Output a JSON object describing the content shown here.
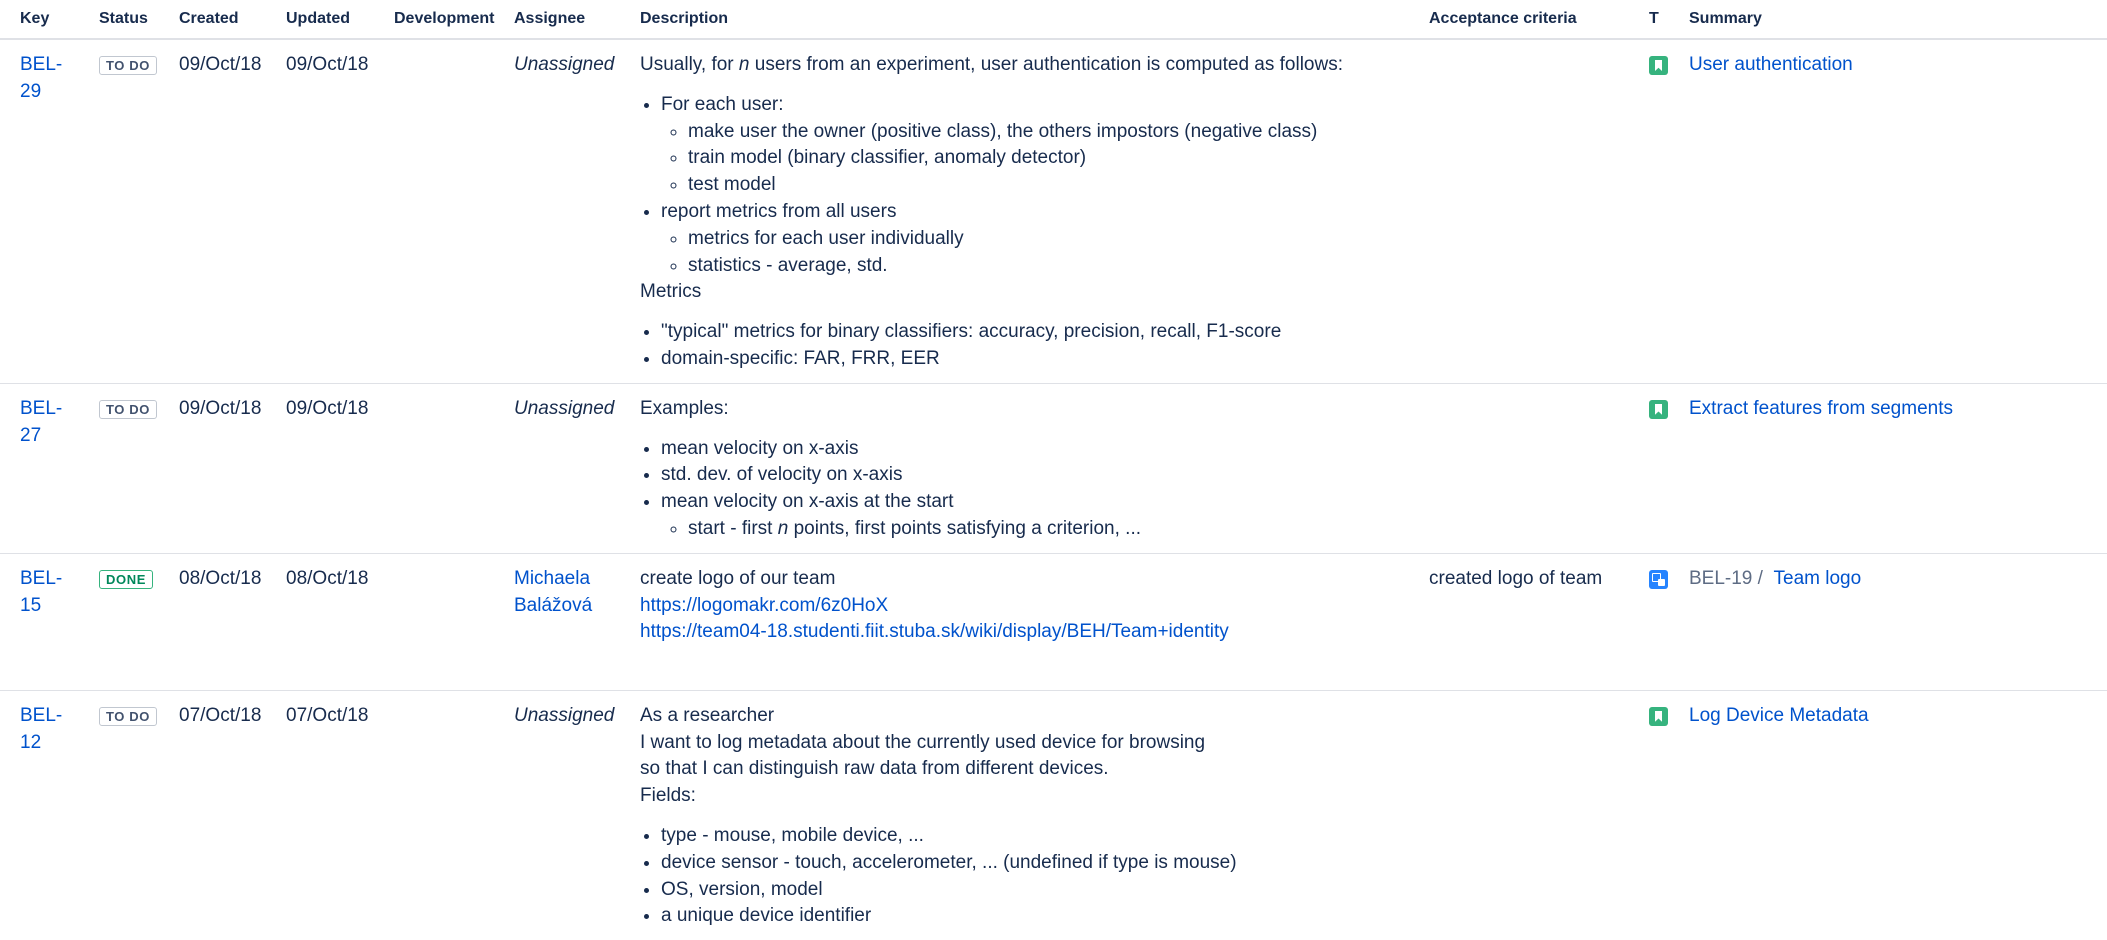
{
  "columns": {
    "key": "Key",
    "status": "Status",
    "created": "Created",
    "updated": "Updated",
    "development": "Development",
    "assignee": "Assignee",
    "description": "Description",
    "acceptance": "Acceptance criteria",
    "type": "T",
    "summary": "Summary"
  },
  "issues": [
    {
      "key": "BEL-29",
      "status": "TO DO",
      "created": "09/Oct/18",
      "updated": "09/Oct/18",
      "assignee": "Unassigned",
      "type_icon": "story-icon",
      "summary": "User authentication",
      "description": {
        "intro_pre": "Usually, for ",
        "intro_em": "n",
        "intro_post": " users from an experiment, user authentication is computed as follows:",
        "list1": [
          {
            "text": "For each user:",
            "sub": [
              "make user the owner (positive class), the others impostors (negative class)",
              "train model (binary classifier, anomaly detector)",
              "test model"
            ]
          },
          {
            "text": "report metrics from all users",
            "sub": [
              "metrics for each user individually",
              "statistics - average, std."
            ]
          }
        ],
        "heading": "Metrics",
        "list2": [
          "\"typical\" metrics for binary classifiers: accuracy, precision, recall, F1-score",
          "domain-specific: FAR, FRR, EER"
        ]
      }
    },
    {
      "key": "BEL-27",
      "status": "TO DO",
      "created": "09/Oct/18",
      "updated": "09/Oct/18",
      "assignee": "Unassigned",
      "type_icon": "story-icon",
      "summary": "Extract features from segments",
      "description": {
        "intro": "Examples:",
        "list": [
          "mean velocity on x-axis",
          "std. dev. of velocity on x-axis",
          "mean velocity on x-axis at the start"
        ],
        "sub_pre": "start - first ",
        "sub_em": "n",
        "sub_post": " points, first points satisfying a criterion, ..."
      }
    },
    {
      "key": "BEL-15",
      "status": "DONE",
      "created": "08/Oct/18",
      "updated": "08/Oct/18",
      "assignee_line1": "Michaela",
      "assignee_line2": "Balážová",
      "type_icon": "subtask-icon",
      "parent_key": "BEL-19 /",
      "summary": "Team logo",
      "acceptance": "created logo of team",
      "description": {
        "line1": "create logo of our team",
        "link1": "https://logomakr.com/6z0HoX",
        "link2": "https://team04-18.studenti.fiit.stuba.sk/wiki/display/BEH/Team+identity"
      }
    },
    {
      "key": "BEL-12",
      "status": "TO DO",
      "created": "07/Oct/18",
      "updated": "07/Oct/18",
      "assignee": "Unassigned",
      "type_icon": "story-icon",
      "summary": "Log Device Metadata",
      "description": {
        "line1": "As a researcher",
        "line2": "I want to log metadata about the currently used device for browsing",
        "line3": "so that I can distinguish raw data from different devices.",
        "line4": "Fields:",
        "list": [
          "type - mouse, mobile device, ...",
          "device sensor - touch, accelerometer, ... (undefined if type is mouse)",
          "OS, version, model",
          "a unique device identifier"
        ]
      }
    }
  ]
}
